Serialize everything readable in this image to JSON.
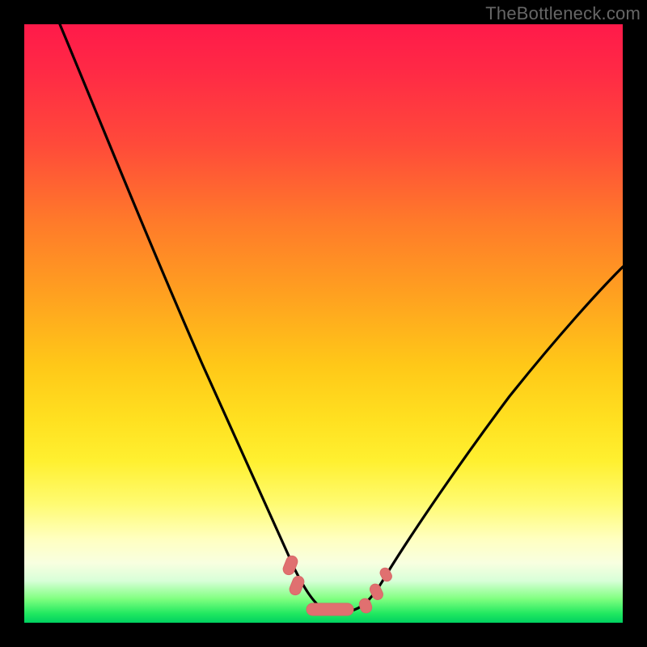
{
  "watermark": {
    "text": "TheBottleneck.com"
  },
  "colors": {
    "frame": "#000000",
    "curve_stroke": "#000000",
    "marker_fill": "#e07070",
    "marker_stroke": "#d86868"
  },
  "chart_data": {
    "type": "line",
    "title": "",
    "xlabel": "",
    "ylabel": "",
    "xlim": [
      0,
      100
    ],
    "ylim": [
      0,
      100
    ],
    "note": "Axes are unlabeled in the source image; values below are normalized 0–100 estimates read from pixel positions. Y increases upward; bottom of plot is 0, top is 100.",
    "left_curve_xy": [
      [
        6,
        100
      ],
      [
        10,
        90
      ],
      [
        15,
        78
      ],
      [
        20,
        66
      ],
      [
        25,
        55
      ],
      [
        30,
        43
      ],
      [
        35,
        31
      ],
      [
        40,
        19
      ],
      [
        43,
        11
      ],
      [
        46,
        4.5
      ],
      [
        48,
        2.5
      ],
      [
        50,
        2
      ]
    ],
    "right_curve_xy": [
      [
        55,
        2
      ],
      [
        57,
        2.5
      ],
      [
        59,
        4
      ],
      [
        62,
        8
      ],
      [
        66,
        14
      ],
      [
        72,
        22
      ],
      [
        80,
        33
      ],
      [
        88,
        44
      ],
      [
        95,
        53
      ],
      [
        100,
        59
      ]
    ],
    "markers_xy": [
      [
        44.3,
        9.5
      ],
      [
        45.4,
        6.1
      ],
      [
        48.0,
        2.4
      ],
      [
        50.0,
        2.0
      ],
      [
        52.4,
        1.9
      ],
      [
        54.7,
        2.0
      ],
      [
        57.0,
        2.8
      ],
      [
        58.8,
        5.0
      ],
      [
        60.5,
        8.1
      ]
    ],
    "gradient_stops": [
      {
        "pos": 0.0,
        "color": "#ff1a4a"
      },
      {
        "pos": 0.33,
        "color": "#ff7a2a"
      },
      {
        "pos": 0.66,
        "color": "#ffe020"
      },
      {
        "pos": 0.9,
        "color": "#f8ffe0"
      },
      {
        "pos": 1.0,
        "color": "#00d060"
      }
    ]
  }
}
